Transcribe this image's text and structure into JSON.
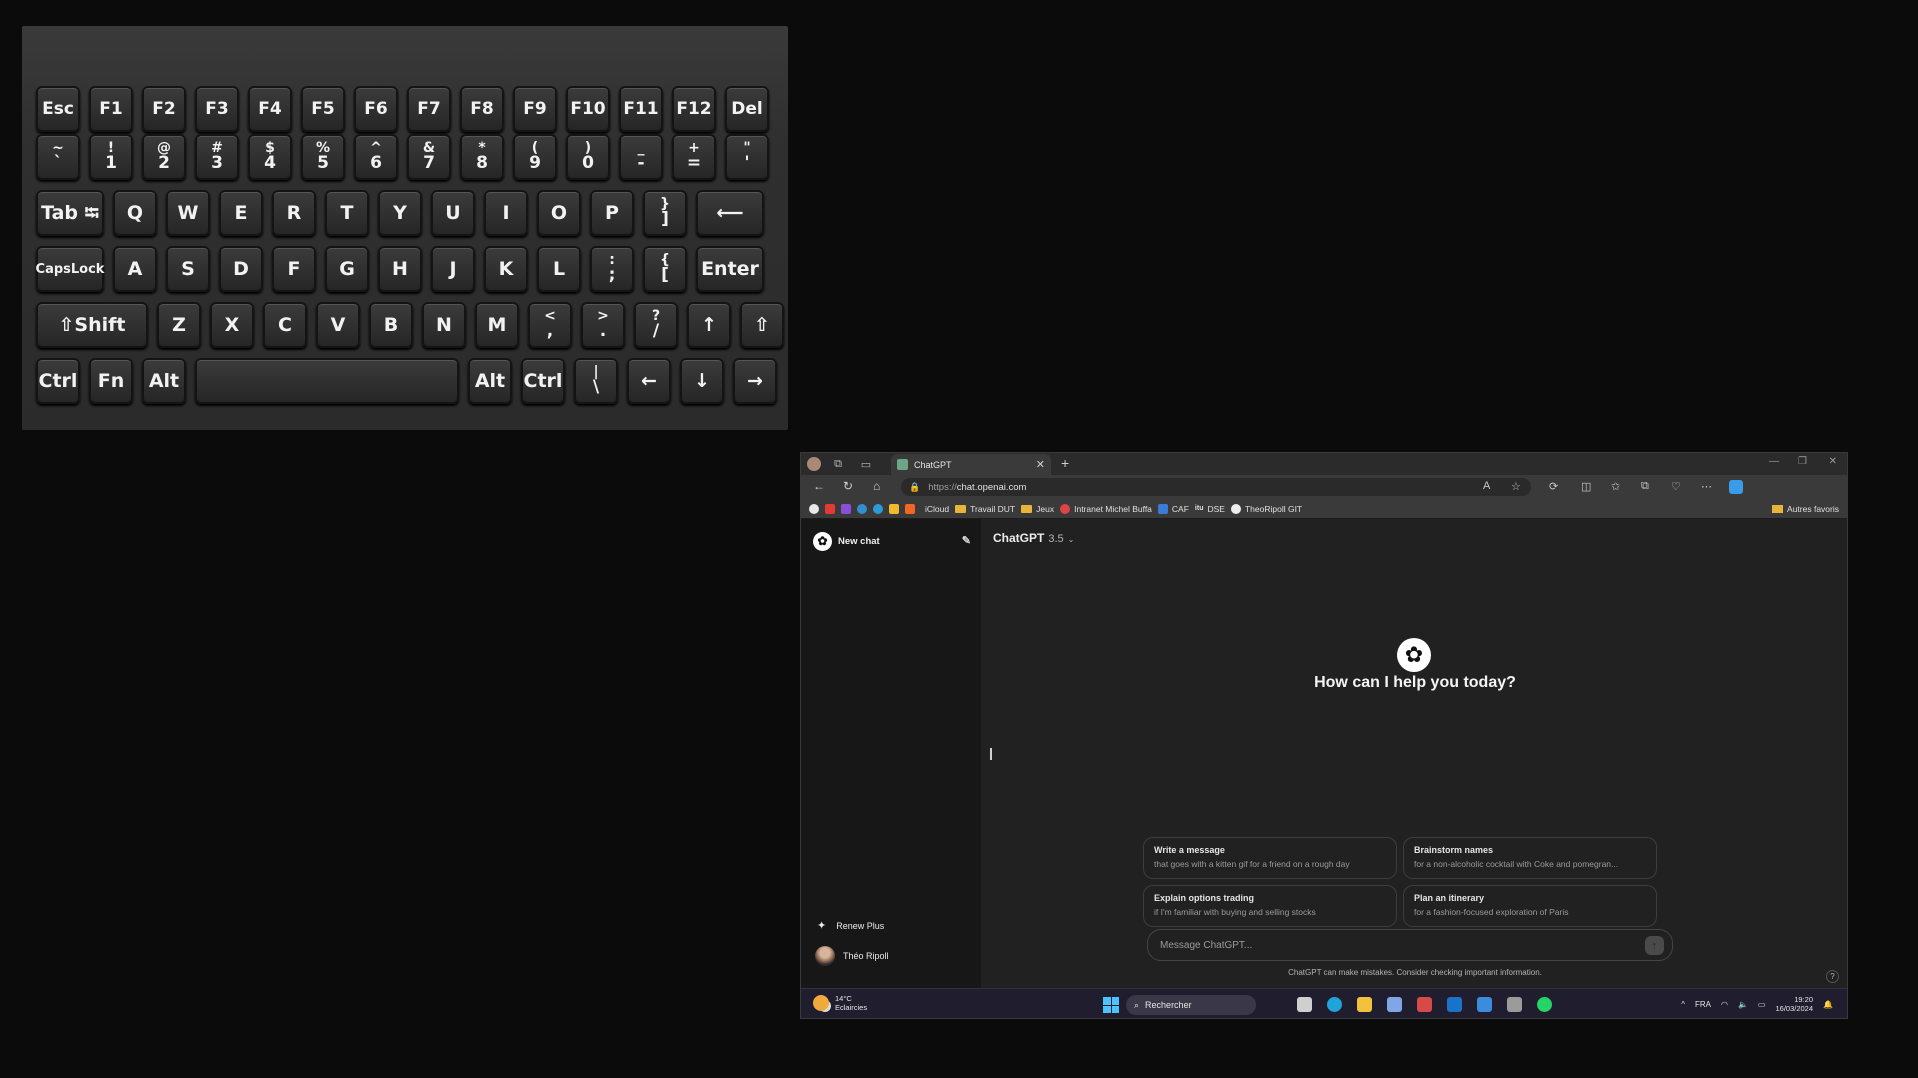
{
  "keyboard": {
    "rows": [
      [
        "Esc",
        "F1",
        "F2",
        "F3",
        "F4",
        "F5",
        "F6",
        "F7",
        "F8",
        "F9",
        "F10",
        "F11",
        "F12",
        "Del"
      ],
      [
        [
          "~",
          "`"
        ],
        [
          "!",
          "1"
        ],
        [
          "@",
          "2"
        ],
        [
          "#",
          "3"
        ],
        [
          "$",
          "4"
        ],
        [
          "%",
          "5"
        ],
        [
          "^",
          "6"
        ],
        [
          "&",
          "7"
        ],
        [
          "*",
          "8"
        ],
        [
          "(",
          "9"
        ],
        [
          ")",
          "0"
        ],
        [
          "_",
          "-"
        ],
        [
          "+",
          "="
        ],
        [
          "\"",
          "'"
        ]
      ],
      [
        "Tab ⭾",
        "Q",
        "W",
        "E",
        "R",
        "T",
        "Y",
        "U",
        "I",
        "O",
        "P",
        [
          "}",
          "]"
        ],
        "⟵"
      ],
      [
        "CapsLock",
        "A",
        "S",
        "D",
        "F",
        "G",
        "H",
        "J",
        "K",
        "L",
        [
          ":",
          ";"
        ],
        [
          "{",
          "["
        ],
        "Enter"
      ],
      [
        "⇧Shift",
        "Z",
        "X",
        "C",
        "V",
        "B",
        "N",
        "M",
        [
          "<",
          ","
        ],
        [
          ">",
          "."
        ],
        [
          "?",
          "/"
        ],
        "↑",
        "⇧"
      ],
      [
        "Ctrl",
        "Fn",
        "Alt",
        "",
        "Alt",
        "Ctrl",
        [
          "|",
          "\\"
        ],
        "←",
        "↓",
        "→"
      ]
    ]
  },
  "browser": {
    "tab_title": "ChatGPT",
    "url_scheme": "https://",
    "url_host": "chat.openai.com",
    "bookmarks": [
      {
        "label": "iCloud",
        "icon": "apple-icon"
      },
      {
        "label": "Travail DUT",
        "icon": "folder-icon"
      },
      {
        "label": "Jeux",
        "icon": "folder-icon"
      },
      {
        "label": "Intranet Michel Buffa",
        "icon": "site-icon"
      },
      {
        "label": "CAF",
        "icon": "site-icon"
      },
      {
        "label": "DSE",
        "icon": "site-icon"
      },
      {
        "label": "TheoRipoll GIT",
        "icon": "github-icon"
      }
    ],
    "bookmarks_other": "Autres favoris"
  },
  "chat": {
    "new_chat": "New chat",
    "model_name": "ChatGPT",
    "model_version": "3.5",
    "greeting": "How can I help you today?",
    "suggestions": [
      {
        "title": "Write a message",
        "subtitle": "that goes with a kitten gif for a friend on a rough day"
      },
      {
        "title": "Brainstorm names",
        "subtitle": "for a non-alcoholic cocktail with Coke and pomegran..."
      },
      {
        "title": "Explain options trading",
        "subtitle": "if I'm familiar with buying and selling stocks"
      },
      {
        "title": "Plan an itinerary",
        "subtitle": "for a fashion-focused exploration of Paris"
      }
    ],
    "input_placeholder": "Message ChatGPT...",
    "disclaimer": "ChatGPT can make mistakes. Consider checking important information.",
    "renew": "Renew Plus",
    "user_name": "Théo Ripoll",
    "help": "?"
  },
  "taskbar": {
    "temp": "14°C",
    "weather": "Eclaircies",
    "search": "Rechercher",
    "lang": "FRA",
    "time": "19:20",
    "date": "16/03/2024"
  }
}
